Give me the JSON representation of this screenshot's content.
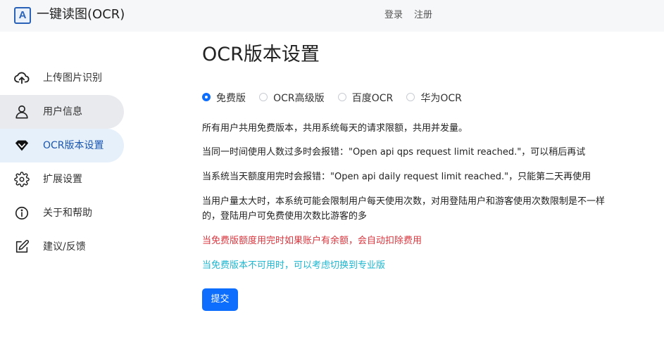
{
  "header": {
    "logo_letter": "A",
    "title": "一键读图(OCR)",
    "login": "登录",
    "register": "注册"
  },
  "sidebar": {
    "items": [
      {
        "label": "上传图片识别",
        "icon": "cloud-upload-icon"
      },
      {
        "label": "用户信息",
        "icon": "user-icon"
      },
      {
        "label": "OCR版本设置",
        "icon": "diamond-icon"
      },
      {
        "label": "扩展设置",
        "icon": "gear-icon"
      },
      {
        "label": "关于和帮助",
        "icon": "info-icon"
      },
      {
        "label": "建议/反馈",
        "icon": "edit-icon"
      }
    ]
  },
  "main": {
    "title": "OCR版本设置",
    "options": [
      {
        "label": "免费版",
        "checked": true
      },
      {
        "label": "OCR高级版",
        "checked": false
      },
      {
        "label": "百度OCR",
        "checked": false
      },
      {
        "label": "华为OCR",
        "checked": false
      }
    ],
    "paragraphs": [
      "所有用户共用免费版本，共用系统每天的请求限额，共用并发量。",
      "当同一时间使用人数过多时会报错：\"Open api qps request limit reached.\"，可以稍后再试",
      "当系统当天额度用完时会报错：\"Open api daily request limit reached.\"，只能第二天再使用",
      "当用户量太大时，本系统可能会限制用户每天使用次数，对用登陆用户和游客使用次数限制是不一样的，登陆用户可免费使用次数比游客的多",
      "当免费版额度用完时如果账户有余额，会自动扣除费用",
      "当免费版本不可用时，可以考虑切换到专业版"
    ],
    "submit_label": "提交"
  },
  "colors": {
    "primary": "#0d6efd",
    "warning_text": "#d9363e",
    "hint_text": "#1fb6cf",
    "sidebar_active_bg": "#e6f0fb",
    "sidebar_hover_bg": "#e9eaee",
    "header_bg": "#f6f7f9"
  }
}
